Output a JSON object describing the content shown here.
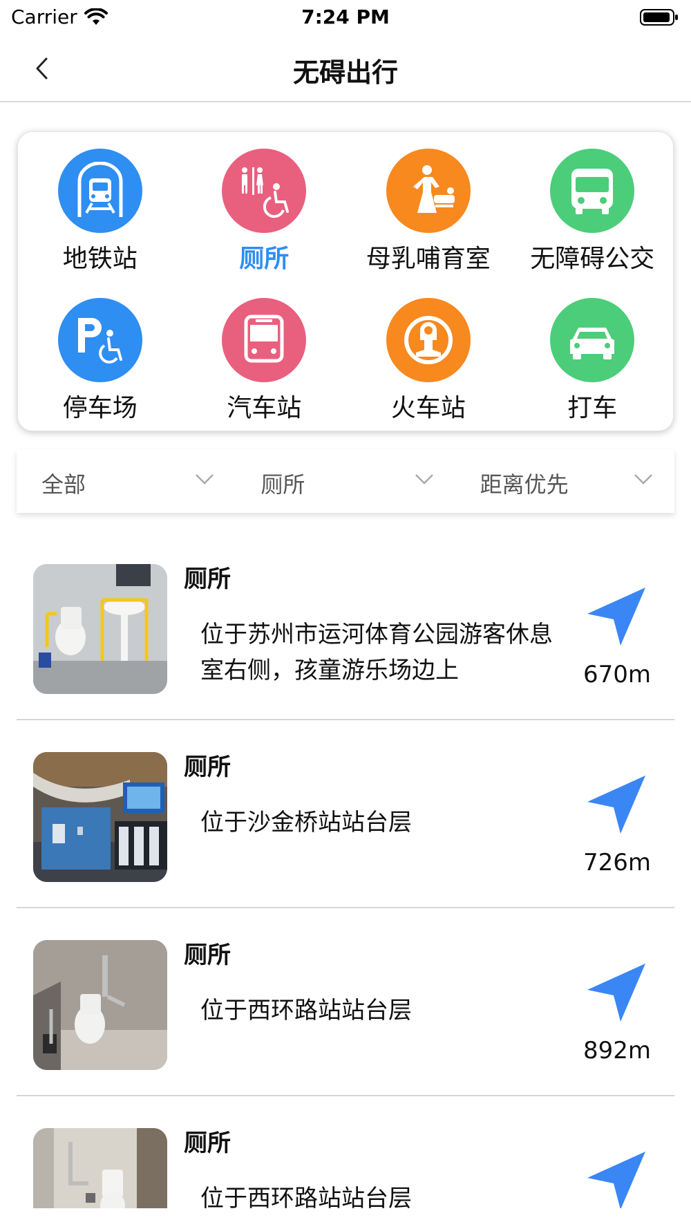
{
  "status_bar": {
    "carrier": "Carrier",
    "time": "7:24 PM"
  },
  "nav": {
    "title": "无碍出行"
  },
  "categories": [
    {
      "label": "地铁站",
      "color": "#2e8ef2",
      "icon": "subway-icon",
      "active": false
    },
    {
      "label": "厕所",
      "color": "#e8607e",
      "icon": "accessible-toilet-icon",
      "active": true
    },
    {
      "label": "母乳哺育室",
      "color": "#f7891f",
      "icon": "nursing-room-icon",
      "active": false
    },
    {
      "label": "无障碍公交",
      "color": "#4ccd7a",
      "icon": "bus-icon",
      "active": false
    },
    {
      "label": "停车场",
      "color": "#2e8ef2",
      "icon": "accessible-parking-icon",
      "active": false
    },
    {
      "label": "汽车站",
      "color": "#e8607e",
      "icon": "coach-station-icon",
      "active": false
    },
    {
      "label": "火车站",
      "color": "#f7891f",
      "icon": "train-station-icon",
      "active": false
    },
    {
      "label": "打车",
      "color": "#4ccd7a",
      "icon": "taxi-icon",
      "active": false
    }
  ],
  "filters": [
    {
      "label": "全部"
    },
    {
      "label": "厕所"
    },
    {
      "label": "距离优先"
    }
  ],
  "results": [
    {
      "title": "厕所",
      "description": "位于苏州市运河体育公园游客休息室右侧，孩童游乐场边上",
      "distance": "670m"
    },
    {
      "title": "厕所",
      "description": "位于沙金桥站站台层",
      "distance": "726m"
    },
    {
      "title": "厕所",
      "description": "位于西环路站站台层",
      "distance": "892m"
    },
    {
      "title": "厕所",
      "description": "位于西环路站站台层",
      "distance": ""
    }
  ],
  "colors": {
    "accent": "#2e8ef2",
    "navigate": "#3a86f5"
  }
}
